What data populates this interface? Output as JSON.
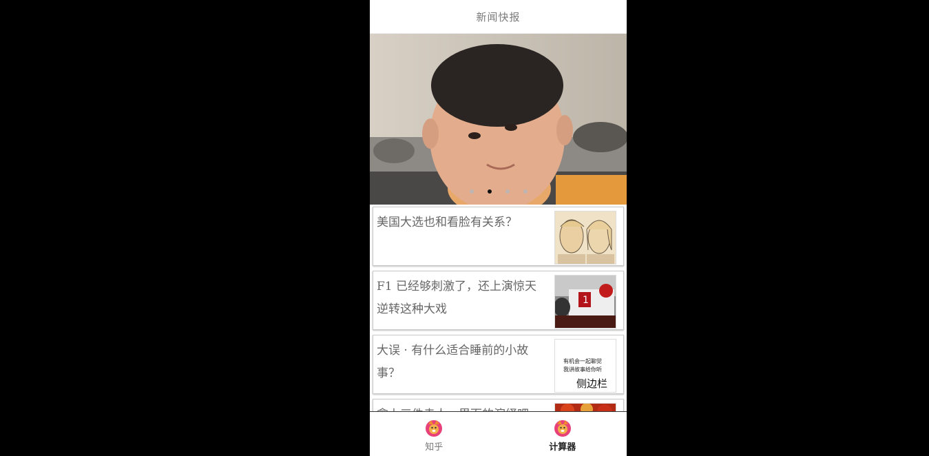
{
  "header": {
    "title": "新闻快报"
  },
  "banner": {
    "slides": 4,
    "active_slide": 2
  },
  "news": [
    {
      "title": "美国大选也和看脸有关系？",
      "thumb_icon": "election-portraits-thumb"
    },
    {
      "title": "F1 已经够刺激了，还上演惊天逆转这种大戏",
      "thumb_icon": "race-car-thumb"
    },
    {
      "title": "大误 · 有什么适合睡前的小故事？",
      "thumb_icon": "text-thumb",
      "thumb_text_1": "有机会一起聊觉",
      "thumb_text_2": "我讲故事给你听",
      "overlay_label": "侧边栏"
    },
    {
      "title": "拿上三件走人，里面的演绎吧",
      "thumb_icon": "food-thumb"
    }
  ],
  "tabs": [
    {
      "label": "知乎",
      "icon": "fox-icon",
      "active": false
    },
    {
      "label": "计算器",
      "icon": "fox-icon",
      "active": true
    }
  ],
  "colors": {
    "background": "#000000",
    "header_text": "#7a7a7a",
    "card_text": "#666666",
    "tab_icon": "#e8417a"
  }
}
